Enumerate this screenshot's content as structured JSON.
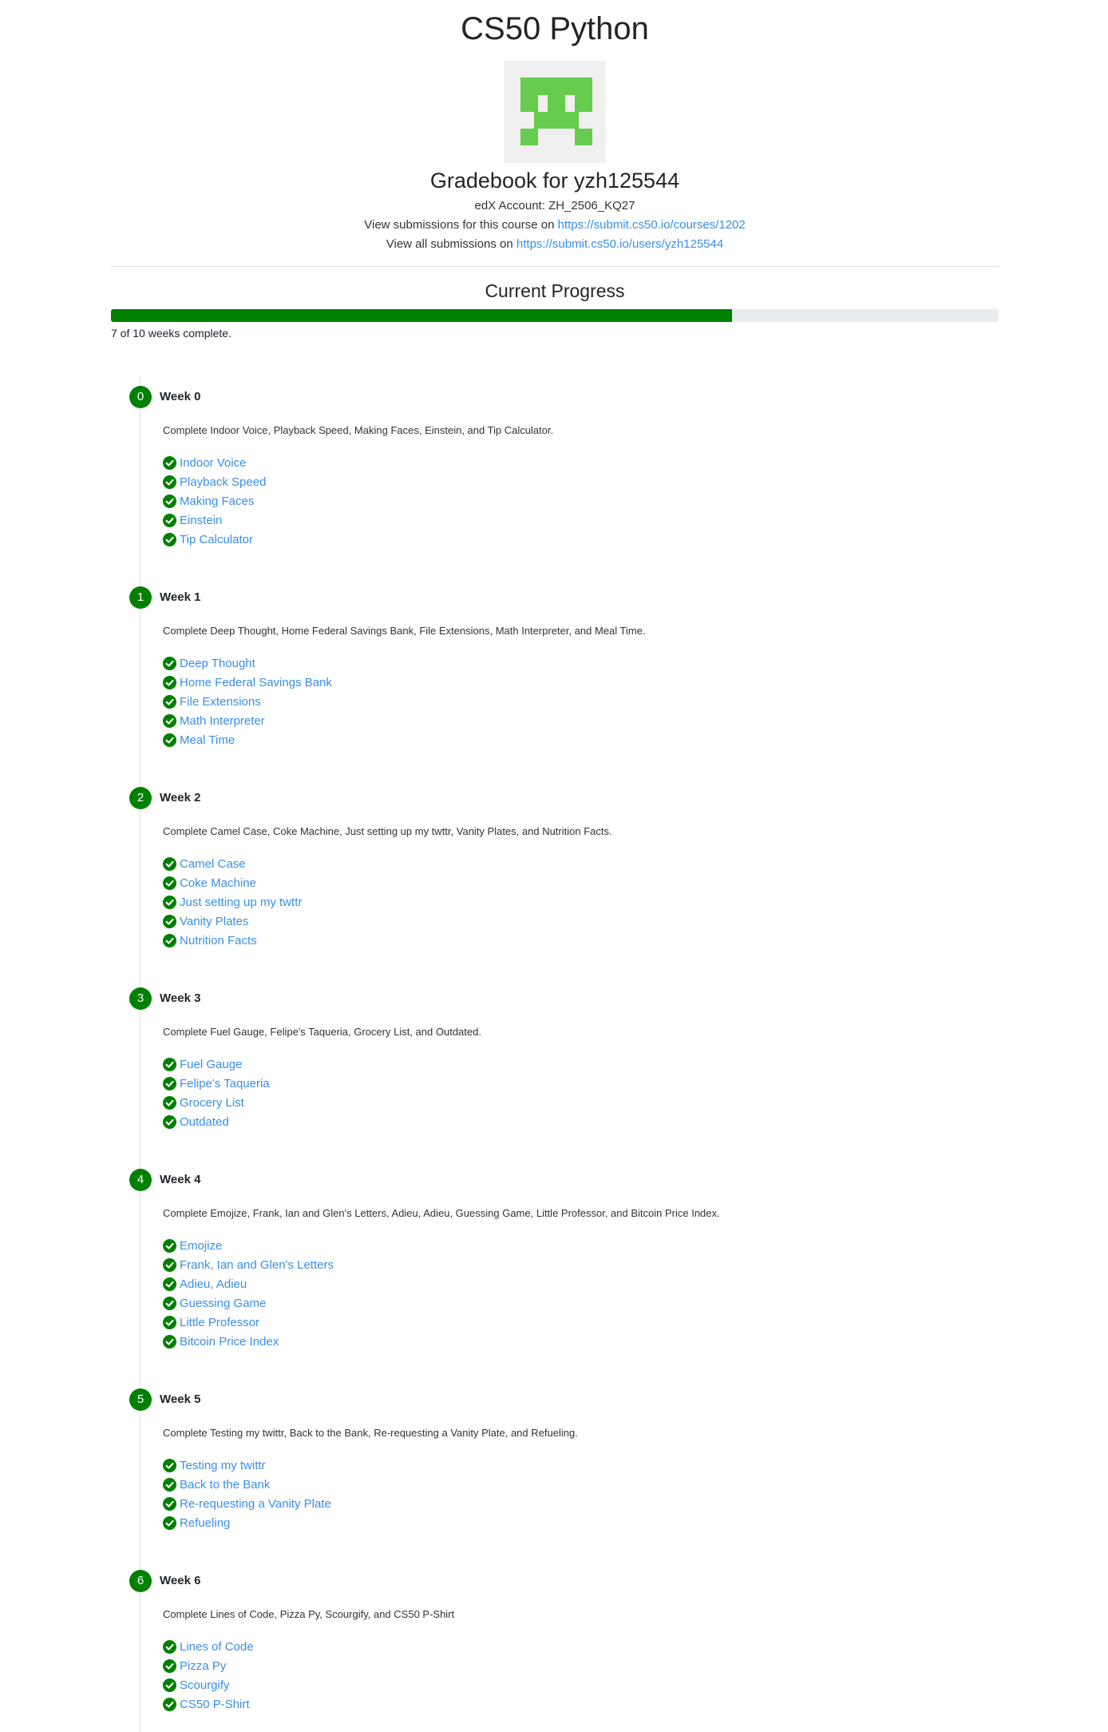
{
  "course_title": "CS50 Python",
  "gradebook_title": "Gradebook for yzh125544",
  "edx_account": "edX Account: ZH_2506_KQ27",
  "course_submissions_prefix": "View submissions for this course on ",
  "course_submissions_link": "https://submit.cs50.io/courses/1202",
  "all_submissions_prefix": "View all submissions on ",
  "all_submissions_link": "https://submit.cs50.io/users/yzh125544",
  "progress": {
    "title": "Current Progress",
    "completed_weeks": 7,
    "total_weeks": 10,
    "fraction": 0.7,
    "text": "7 of 10 weeks complete."
  },
  "colors": {
    "accent": "#008000",
    "link": "#3a8ee6",
    "avatar_pixel": "#66cc4e"
  },
  "icons": {
    "check": "check-circle-icon"
  },
  "weeks": [
    {
      "number": "0",
      "label": "Week 0",
      "description": "Complete Indoor Voice, Playback Speed, Making Faces, Einstein, and Tip Calculator.",
      "items": [
        "Indoor Voice",
        "Playback Speed",
        "Making Faces",
        "Einstein",
        "Tip Calculator"
      ]
    },
    {
      "number": "1",
      "label": "Week 1",
      "description": "Complete Deep Thought, Home Federal Savings Bank, File Extensions, Math Interpreter, and Meal Time.",
      "items": [
        "Deep Thought",
        "Home Federal Savings Bank",
        "File Extensions",
        "Math Interpreter",
        "Meal Time"
      ]
    },
    {
      "number": "2",
      "label": "Week 2",
      "description": "Complete Camel Case, Coke Machine, Just setting up my twttr, Vanity Plates, and Nutrition Facts.",
      "items": [
        "Camel Case",
        "Coke Machine",
        "Just setting up my twttr",
        "Vanity Plates",
        "Nutrition Facts"
      ]
    },
    {
      "number": "3",
      "label": "Week 3",
      "description": "Complete Fuel Gauge, Felipe's Taqueria, Grocery List, and Outdated.",
      "items": [
        "Fuel Gauge",
        "Felipe's Taqueria",
        "Grocery List",
        "Outdated"
      ]
    },
    {
      "number": "4",
      "label": "Week 4",
      "description": "Complete Emojize, Frank, Ian and Glen's Letters, Adieu, Adieu, Guessing Game, Little Professor, and Bitcoin Price Index.",
      "items": [
        "Emojize",
        "Frank, Ian and Glen's Letters",
        "Adieu, Adieu",
        "Guessing Game",
        "Little Professor",
        "Bitcoin Price Index"
      ]
    },
    {
      "number": "5",
      "label": "Week 5",
      "description": "Complete Testing my twittr, Back to the Bank, Re-requesting a Vanity Plate, and Refueling.",
      "items": [
        "Testing my twittr",
        "Back to the Bank",
        "Re-requesting a Vanity Plate",
        "Refueling"
      ]
    },
    {
      "number": "6",
      "label": "Week 6",
      "description": "Complete Lines of Code, Pizza Py, Scourgify, and CS50 P-Shirt",
      "items": [
        "Lines of Code",
        "Pizza Py",
        "Scourgify",
        "CS50 P-Shirt"
      ]
    }
  ]
}
